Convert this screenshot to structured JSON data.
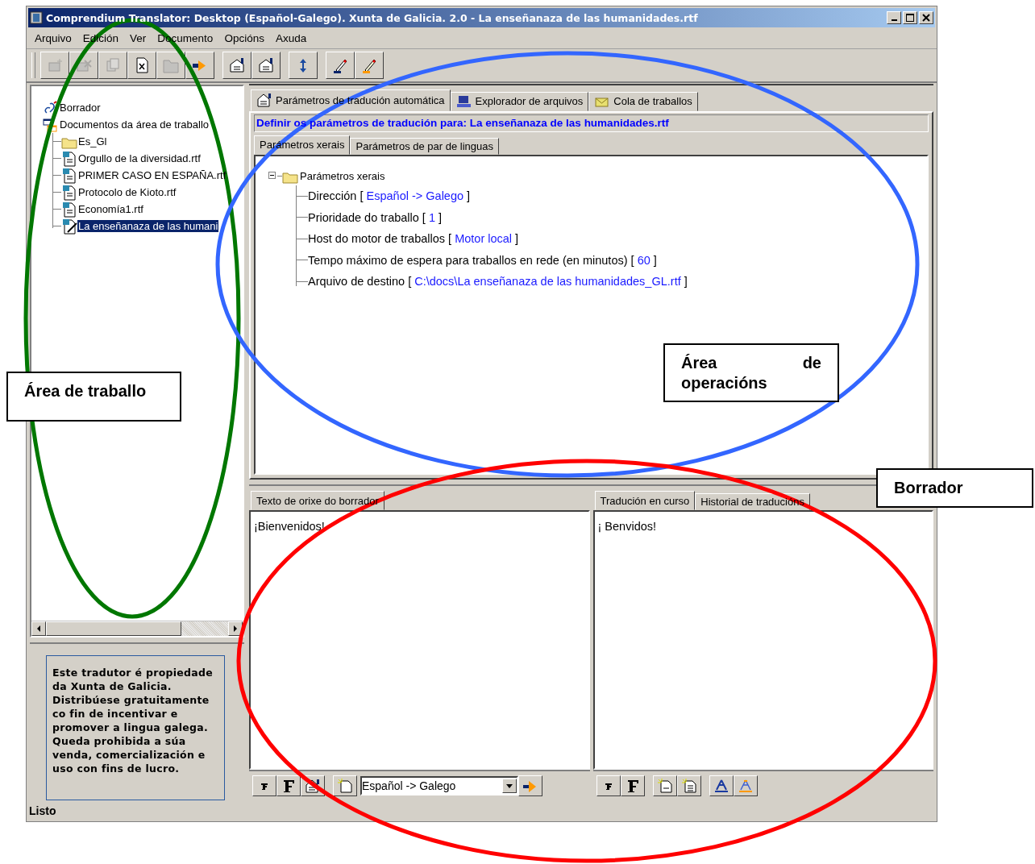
{
  "window": {
    "title": "Comprendium Translator: Desktop (Español-Galego). Xunta de Galicia. 2.0 - La enseñanaza de las humanidades.rtf"
  },
  "menu": [
    "Arquivo",
    "Edición",
    "Ver",
    "Documento",
    "Opcións",
    "Axuda"
  ],
  "workspace_tree": [
    {
      "label": "Borrador",
      "kind": "draft",
      "selected": false
    },
    {
      "label": "Documentos da área de traballo",
      "kind": "workspace",
      "selected": false,
      "children": [
        {
          "label": "Es_Gl",
          "kind": "folder",
          "selected": false
        },
        {
          "label": "Orgullo de la diversidad.rtf",
          "kind": "document",
          "selected": false
        },
        {
          "label": "PRIMER CASO EN ESPAÑA.rtf",
          "kind": "document",
          "selected": false
        },
        {
          "label": "Protocolo de Kioto.rtf",
          "kind": "document",
          "selected": false
        },
        {
          "label": "Economía1.rtf",
          "kind": "document",
          "selected": false
        },
        {
          "label": "La enseñanaza de las humani",
          "kind": "edited-document",
          "selected": true
        }
      ]
    }
  ],
  "info_text": "Este tradutor é propiedade da Xunta de Galicia. Distribúese gratuitamente co fin de incentivar e promover a lingua galega. Queda prohibida a súa venda, comercialización e uso con fins de lucro.",
  "status_bar": "Listo",
  "main_tabs": [
    {
      "label": "Parámetros de tradución automática",
      "kind": "properties",
      "selected": true
    },
    {
      "label": "Explorador de arquivos",
      "kind": "computer",
      "selected": false
    },
    {
      "label": "Cola de traballos",
      "kind": "mail",
      "selected": false
    }
  ],
  "heading": "Definir os parámetros de tradución para: La enseñanaza de las humanidades.rtf",
  "sub_tabs": [
    {
      "label": "Parámetros xerais",
      "selected": true
    },
    {
      "label": "Parámetros de par de linguas",
      "selected": false
    }
  ],
  "parameters": {
    "label": "Parámetros xerais",
    "expanded": true,
    "children": [
      {
        "label": "Dirección [",
        "value": "Español -> Galego",
        "suffix": "]"
      },
      {
        "label": "Prioridade do traballo [",
        "value": "1",
        "suffix": "]"
      },
      {
        "label": "Host do motor de traballos [",
        "value": "Motor local",
        "suffix": "]"
      },
      {
        "label": "Tempo máximo de espera para traballos en rede (en minutos) [",
        "value": "60",
        "suffix": "]"
      },
      {
        "label": "Arquivo de destino [",
        "value": "C:\\docs\\La enseñanaza de las humanidades_GL.rtf",
        "suffix": "]"
      }
    ]
  },
  "source_panel": {
    "tabs": [
      {
        "label": "Texto de orixe do borrador",
        "selected": true
      }
    ],
    "text": "¡Bienvenidos!",
    "language": "Español -> Galego"
  },
  "target_panel": {
    "tabs": [
      {
        "label": "Tradución en curso",
        "selected": true
      },
      {
        "label": "Historial de traducións",
        "selected": false
      }
    ],
    "text": "¡ Benvidos!"
  },
  "annotations": {
    "callouts": [
      {
        "text": "Área de traballo",
        "kind": "work"
      },
      {
        "text": "Área de operacións",
        "kind": "operations"
      },
      {
        "text": "Borrador",
        "kind": "draft"
      }
    ],
    "ellipses": [
      {
        "kind": "work",
        "color": "#007700"
      },
      {
        "kind": "operations",
        "color": "#3366ff"
      },
      {
        "kind": "draft",
        "color": "#ff0000"
      }
    ]
  }
}
